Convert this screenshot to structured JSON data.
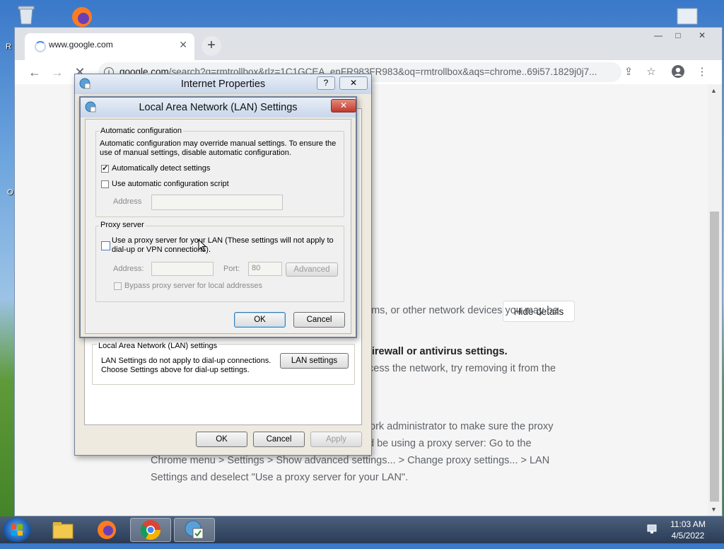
{
  "desktop": {
    "left_labels": [
      "R",
      "O"
    ]
  },
  "browser": {
    "tab_title": "www.google.com",
    "tab_close": "✕",
    "new_tab": "+",
    "url_host": "google.com",
    "url_path": "/search?q=rmtrollbox&rlz=1C1GCEA_enFR983FR983&oq=rmtrollbox&aqs=chrome..69i57.1829j0j7...",
    "window_controls": [
      "—",
      "□",
      "✕"
    ]
  },
  "page": {
    "hide_details": "Hide details",
    "line1": "ams, or other network devices you may be",
    "line2": "firewall or antivirus settings.",
    "line3": "cess the network, try removing it from the",
    "line4": "ork administrator to make sure the proxy",
    "line5": "d be using a proxy server: Go to the",
    "line6": "Chrome menu > Settings > Show advanced settings... > Change proxy settings... > LAN",
    "line7": "Settings and deselect \"Use a proxy server for your LAN\"."
  },
  "internet_properties": {
    "title": "Internet Properties",
    "help": "?",
    "close": "✕",
    "lan_group_label": "Local Area Network (LAN) settings",
    "lan_text_1": "LAN Settings do not apply to dial-up connections.",
    "lan_text_2": "Choose Settings above for dial-up settings.",
    "lan_settings_button": "LAN settings",
    "ok": "OK",
    "cancel": "Cancel",
    "apply": "Apply"
  },
  "lan_dialog": {
    "title": "Local Area Network (LAN) Settings",
    "close": "✕",
    "auto_group": "Automatic configuration",
    "auto_desc_1": "Automatic configuration may override manual settings.  To ensure the",
    "auto_desc_2": "use of manual settings, disable automatic configuration.",
    "auto_detect_label": "Automatically detect settings",
    "auto_detect_checked": true,
    "auto_script_label": "Use automatic configuration script",
    "auto_script_checked": false,
    "address_label": "Address",
    "proxy_group": "Proxy server",
    "proxy_label_1": "Use a proxy server for your LAN (These settings will not apply to",
    "proxy_label_2": "dial-up or VPN connections).",
    "proxy_checked": false,
    "proxy_address_label": "Address:",
    "port_label": "Port:",
    "port_value": "80",
    "advanced": "Advanced",
    "bypass_label": "Bypass proxy server for local addresses",
    "bypass_checked": false,
    "ok": "OK",
    "cancel": "Cancel"
  },
  "taskbar": {
    "time": "11:03 AM",
    "date": "4/5/2022"
  }
}
